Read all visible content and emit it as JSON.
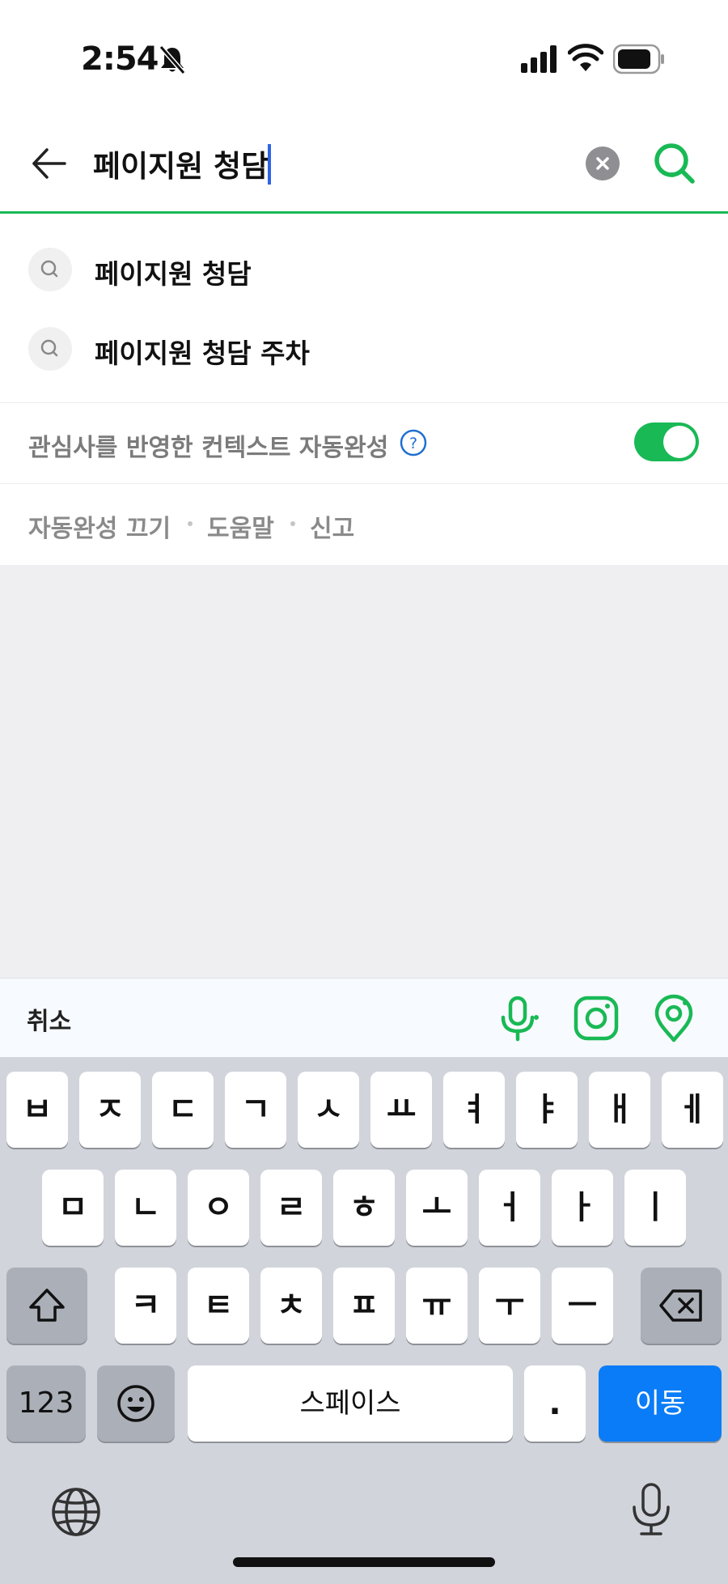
{
  "status_bar": {
    "time": "2:54"
  },
  "search": {
    "query": "페이지원 청담",
    "placeholder": ""
  },
  "suggestions": [
    {
      "label": "페이지원 청담"
    },
    {
      "label": "페이지원 청담 주차"
    }
  ],
  "context": {
    "label": "관심사를 반영한 컨텍스트 자동완성",
    "toggle_on": true
  },
  "footer_links": {
    "off": "자동완성 끄기",
    "help": "도움말",
    "report": "신고"
  },
  "accessory": {
    "cancel": "취소",
    "icons": [
      "microphone-icon",
      "camera-lens-icon",
      "location-pin-icon"
    ]
  },
  "keyboard": {
    "row1": [
      "ㅂ",
      "ㅈ",
      "ㄷ",
      "ㄱ",
      "ㅅ",
      "ㅛ",
      "ㅕ",
      "ㅑ",
      "ㅐ",
      "ㅔ"
    ],
    "row2": [
      "ㅁ",
      "ㄴ",
      "ㅇ",
      "ㄹ",
      "ㅎ",
      "ㅗ",
      "ㅓ",
      "ㅏ",
      "ㅣ"
    ],
    "row3": [
      "ㅋ",
      "ㅌ",
      "ㅊ",
      "ㅍ",
      "ㅠ",
      "ㅜ",
      "ㅡ"
    ],
    "numbers": "123",
    "space": "스페이스",
    "period": ".",
    "go": "이동"
  },
  "colors": {
    "accent_green": "#19b955",
    "keyboard_blue": "#0a7cf7",
    "caret_blue": "#2e64e6"
  }
}
